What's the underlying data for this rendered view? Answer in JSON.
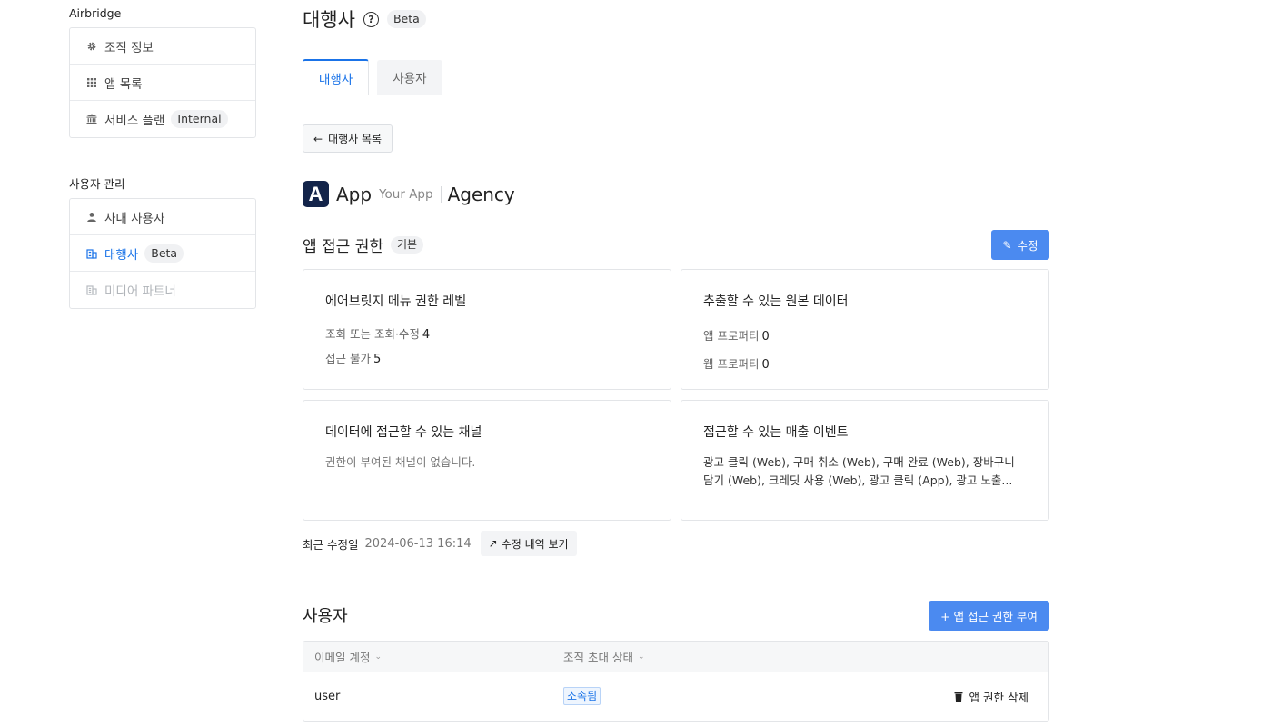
{
  "sidebar": {
    "org_heading": "Airbridge",
    "org_items": [
      {
        "label": "조직 정보",
        "icon": "gear-icon"
      },
      {
        "label": "앱 목록",
        "icon": "grid-icon"
      },
      {
        "label": "서비스 플랜",
        "icon": "bank-icon",
        "badge": "Internal"
      }
    ],
    "user_heading": "사용자 관리",
    "user_items": [
      {
        "label": "사내 사용자",
        "icon": "person-icon"
      },
      {
        "label": "대행사",
        "icon": "building-icon",
        "badge": "Beta",
        "active": true
      },
      {
        "label": "미디어 파트너",
        "icon": "building-icon",
        "disabled": true
      }
    ]
  },
  "header": {
    "title": "대행사",
    "badge": "Beta",
    "help_symbol": "?"
  },
  "tabs": [
    {
      "label": "대행사",
      "active": true
    },
    {
      "label": "사용자",
      "active": false
    }
  ],
  "back_button": {
    "arrow": "←",
    "label": "대행사 목록"
  },
  "app": {
    "logo_letter": "A",
    "name": "App",
    "sub": "Your App",
    "agency": "Agency"
  },
  "access": {
    "title": "앱 접근 권한",
    "badge": "기본",
    "edit_label": "수정",
    "edit_icon": "✎",
    "cards": {
      "menu_level": {
        "title": "에어브릿지 메뉴 권한 레벨",
        "lines": [
          {
            "label": "조회 또는 조회·수정",
            "value": "4"
          },
          {
            "label": "접근 불가",
            "value": "5"
          }
        ]
      },
      "raw_data": {
        "title": "추출할 수 있는 원본 데이터",
        "lines": [
          {
            "label": "앱 프로퍼티",
            "value": "0"
          },
          {
            "label": "웹 프로퍼티",
            "value": "0"
          }
        ]
      },
      "channels": {
        "title": "데이터에 접근할 수 있는 채널",
        "text": "권한이 부여된 채널이 없습니다."
      },
      "revenue_events": {
        "title": "접근할 수 있는 매출 이벤트",
        "text": "광고 클릭 (Web), 구매 취소 (Web), 구매 완료 (Web), 장바구니 담기 (Web), 크레딧 사용 (Web), 광고 클릭 (App), 광고 노출..."
      }
    },
    "modified_label": "최근 수정일",
    "modified_date": "2024-06-13 16:14",
    "history_arrow": "↗",
    "history_label": "수정 내역 보기"
  },
  "users": {
    "title": "사용자",
    "grant_button": "+ 앱 접근 권한 부여",
    "columns": [
      "이메일 계정",
      "조직 초대 상태"
    ],
    "chevron": "⌄",
    "rows": [
      {
        "email": "user",
        "status": "소속됨",
        "action": "앱 권한 삭제"
      }
    ]
  },
  "colors": {
    "accent": "#1a73e8",
    "primary_button": "#4b8af0",
    "logo_bg": "#13244a"
  }
}
